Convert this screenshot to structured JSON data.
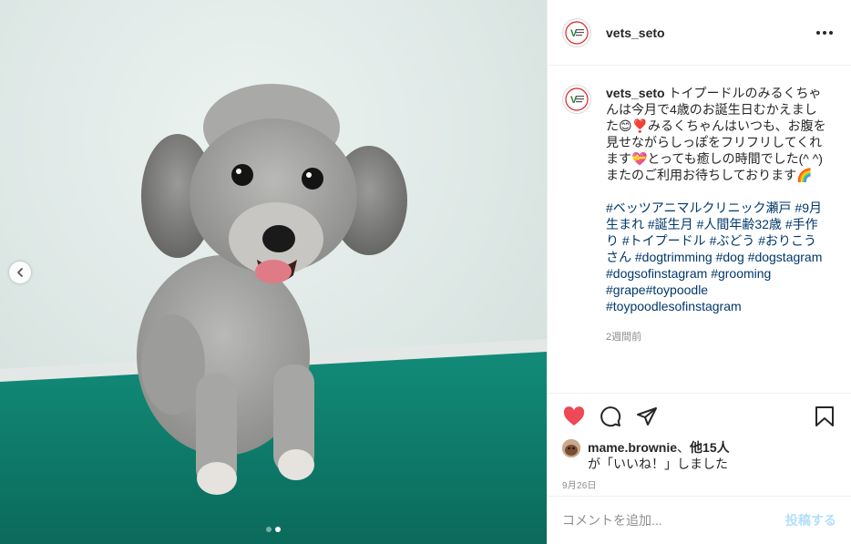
{
  "post": {
    "username": "vets_seto",
    "caption_line1": "トイプードルのみるくちゃんは今月で4歳のお誕生日むかえました😊❣️みるくちゃんはいつも、お腹を見せながらしっぽをフリフリしてくれます💝とっても癒しの時間でした(^ ^)",
    "caption_line2": "またのご利用お待ちしております🌈",
    "hashtags": [
      "#ベッツアニマルクリニック瀬戸",
      "#9月生まれ",
      "#誕生月",
      "#人間年齢32歳",
      "#手作り",
      "#トイプードル",
      "#ぶどう",
      "#おりこうさん",
      "#dogtrimming",
      "#dog",
      "#dogstagram",
      "#dogsofinstagram",
      "#grooming",
      "#grape#toypoodle",
      "#toypoodlesofinstagram"
    ],
    "time_ago": "2週間前",
    "likes_user": "mame.brownie",
    "likes_sep": "、",
    "likes_others": "他15人",
    "likes_suffix": "が「いいね！」しました",
    "date": "9月26日",
    "comment_placeholder": "コメントを追加...",
    "post_button": "投稿する"
  },
  "carousel": {
    "total": 2,
    "current": 2
  },
  "colors": {
    "like": "#ed4956",
    "link": "#00376b",
    "muted": "#8e8e8e",
    "post_disabled": "#b2dffc",
    "table": "#0e7a68",
    "wall": "#dfe9e7"
  },
  "icons": [
    "chevron-left-icon",
    "more-icon",
    "heart-icon",
    "comment-icon",
    "share-icon",
    "bookmark-icon"
  ]
}
